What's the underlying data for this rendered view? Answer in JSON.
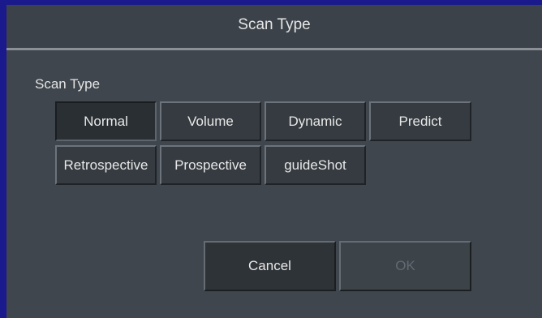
{
  "dialog": {
    "title": "Scan Type"
  },
  "group": {
    "label": "Scan Type",
    "options": [
      {
        "label": "Normal",
        "selected": true
      },
      {
        "label": "Volume",
        "selected": false
      },
      {
        "label": "Dynamic",
        "selected": false
      },
      {
        "label": "Predict",
        "selected": false
      },
      {
        "label": "Retrospective",
        "selected": false
      },
      {
        "label": "Prospective",
        "selected": false
      },
      {
        "label": "guideShot",
        "selected": false
      }
    ]
  },
  "actions": {
    "cancel_label": "Cancel",
    "ok_label": "OK",
    "ok_enabled": false
  },
  "colors": {
    "background": "#1a1a8c",
    "dialog": "#3f464d",
    "button": "#353b40",
    "text": "#e8e8e8",
    "disabled_text": "#626a72"
  }
}
